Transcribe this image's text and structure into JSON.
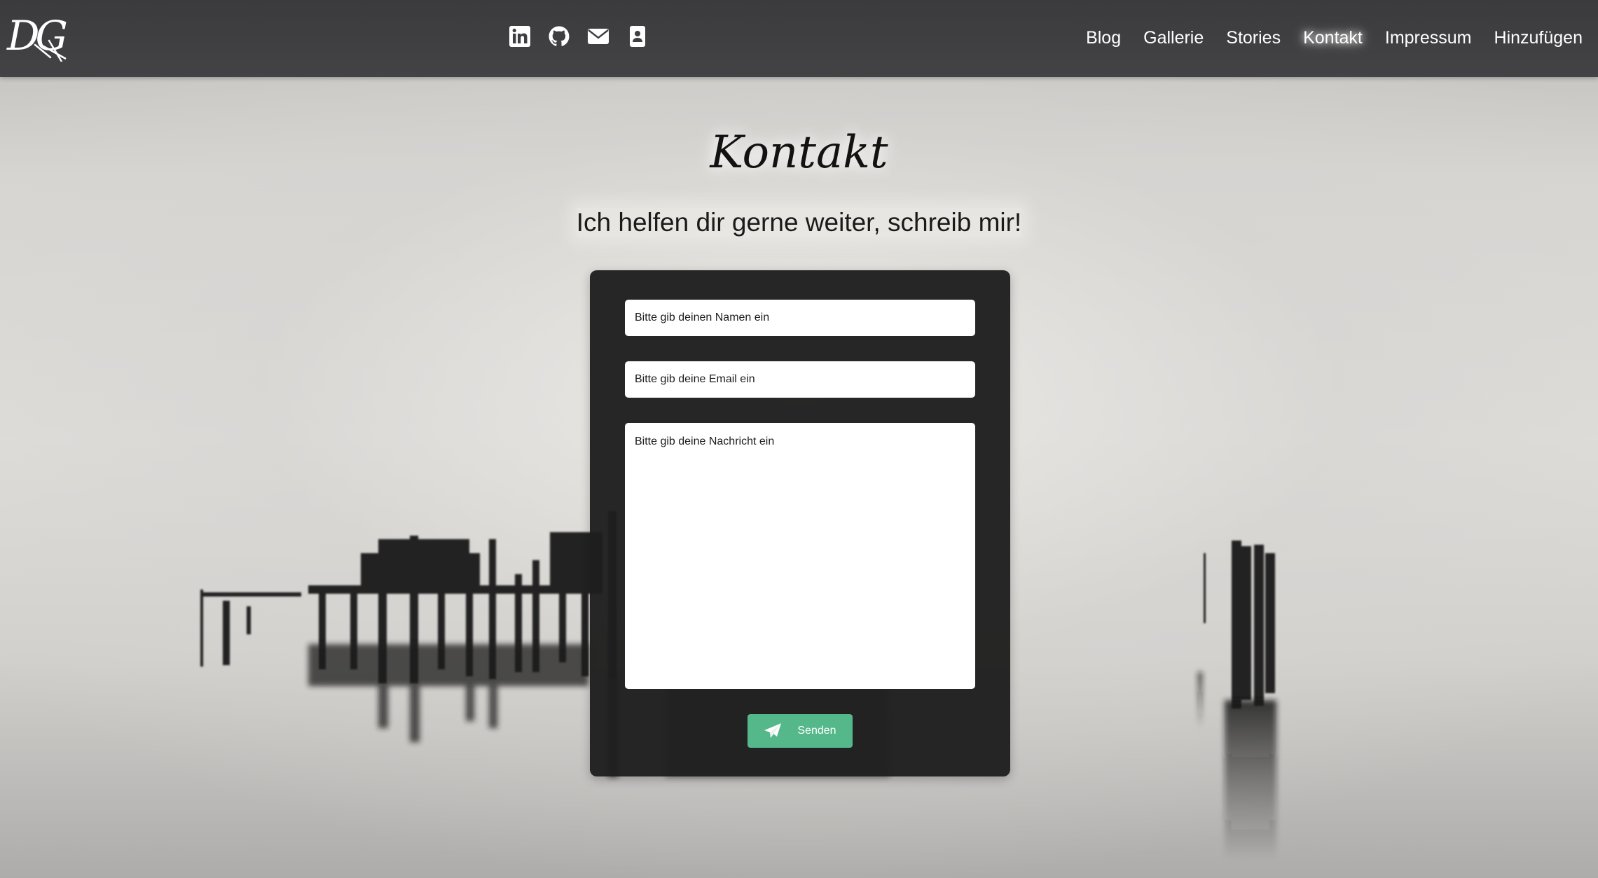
{
  "nav": {
    "logo_text": "DG",
    "social_icons": [
      {
        "name": "linkedin-icon"
      },
      {
        "name": "github-icon"
      },
      {
        "name": "envelope-icon"
      },
      {
        "name": "contact-card-icon"
      }
    ],
    "links": [
      {
        "label": "Blog",
        "active": false
      },
      {
        "label": "Gallerie",
        "active": false
      },
      {
        "label": "Stories",
        "active": false
      },
      {
        "label": "Kontakt",
        "active": true
      },
      {
        "label": "Impressum",
        "active": false
      },
      {
        "label": "Hinzufügen",
        "active": false
      }
    ]
  },
  "main": {
    "title": "Kontakt",
    "subtitle": "Ich helfen dir gerne weiter, schreib mir!"
  },
  "form": {
    "name_placeholder": "Bitte gib deinen Namen ein",
    "email_placeholder": "Bitte gib deine Email ein",
    "message_placeholder": "Bitte gib deine Nachricht ein",
    "submit_label": "Senden",
    "submit_icon": "paper-plane-icon"
  },
  "colors": {
    "navbar": "#3e3e40",
    "card": "#1e1e1e",
    "submit_button": "#54b88a"
  }
}
